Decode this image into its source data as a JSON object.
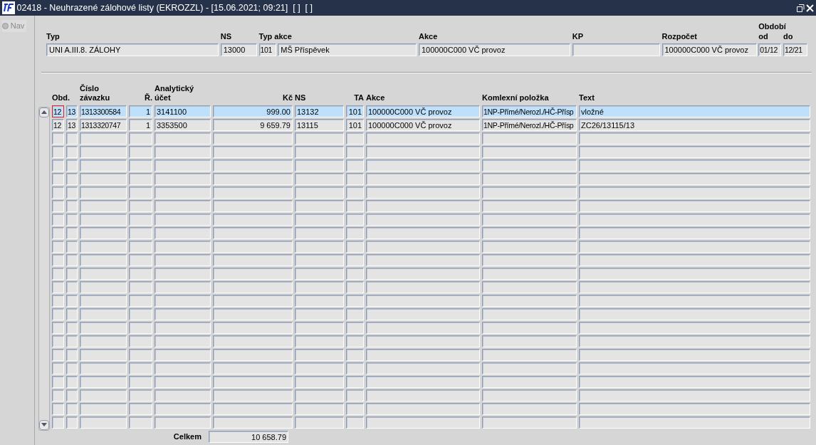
{
  "window": {
    "title": "02418 - Neuhrazené zálohové listy (EKROZZL) - [15.06.2021; 09:21]  [ ]  [ ]"
  },
  "sidebar": {
    "nav_label": "Nav",
    "selected": false
  },
  "header": {
    "fields": [
      {
        "label": "Typ",
        "value": "UNI A.III.8. ZÁLOHY"
      },
      {
        "label": "NS",
        "value": "13000"
      },
      {
        "label": "Typ akce",
        "value": "101"
      },
      {
        "value": "MŠ Příspěvek"
      },
      {
        "label": "Akce",
        "value": "100000C000 VČ provoz"
      },
      {
        "label": "KP"
      },
      {
        "label": "Rozpočet",
        "value": "100000C000 VČ provoz"
      },
      {
        "group_label": "Období",
        "fields": [
          {
            "label": "od",
            "value": "01/12"
          },
          {
            "label": "do",
            "value": "12/21"
          }
        ]
      }
    ]
  },
  "table": {
    "columns": [
      {
        "label": "Obd.",
        "kind": "text"
      },
      {
        "kind": "text"
      },
      {
        "label": "Číslo závazku",
        "kind": "text"
      },
      {
        "label": "Ř.",
        "kind": "number"
      },
      {
        "label": "Analytický účet",
        "kind": "text"
      },
      {
        "label": "Kč",
        "kind": "number"
      },
      {
        "label": "NS",
        "kind": "text"
      },
      {
        "label": "TA",
        "kind": "number"
      },
      {
        "label": "Akce",
        "kind": "text"
      },
      {
        "label": "Komlexní položka",
        "kind": "text"
      },
      {
        "label": "Text",
        "kind": "text"
      }
    ],
    "rows": [
      {
        "selected": true,
        "cells": [
          {
            "text": "12",
            "focused": true
          },
          {
            "text": "13",
            "focused": false
          },
          {
            "text": "1313300584",
            "focused": false
          },
          {
            "text": "1",
            "focused": false
          },
          {
            "text": "3141100",
            "focused": false
          },
          {
            "text": "999.00",
            "focused": false
          },
          {
            "text": "13132",
            "focused": false
          },
          {
            "text": "101",
            "focused": false
          },
          {
            "text": "100000C000 VČ provoz",
            "focused": false
          },
          {
            "text": "1NP-Přímé/Nerozl./HČ-Přísp",
            "focused": false
          },
          {
            "text": "vložné",
            "focused": false
          }
        ]
      },
      {
        "selected": false,
        "cells": [
          {
            "text": "12",
            "focused": false
          },
          {
            "text": "13",
            "focused": false
          },
          {
            "text": "1313320747",
            "focused": false
          },
          {
            "text": "1",
            "focused": false
          },
          {
            "text": "3353500",
            "focused": false
          },
          {
            "text": "9 659.79",
            "focused": false
          },
          {
            "text": "13115",
            "focused": false
          },
          {
            "text": "101",
            "focused": false
          },
          {
            "text": "100000C000 VČ provoz",
            "focused": false
          },
          {
            "text": "1NP-Přímé/Nerozl./HČ-Přísp",
            "focused": false
          },
          {
            "text": "ZC26/13115/13",
            "focused": false
          }
        ]
      }
    ],
    "total": {
      "label": "Celkem",
      "value": "10 658.79"
    }
  }
}
